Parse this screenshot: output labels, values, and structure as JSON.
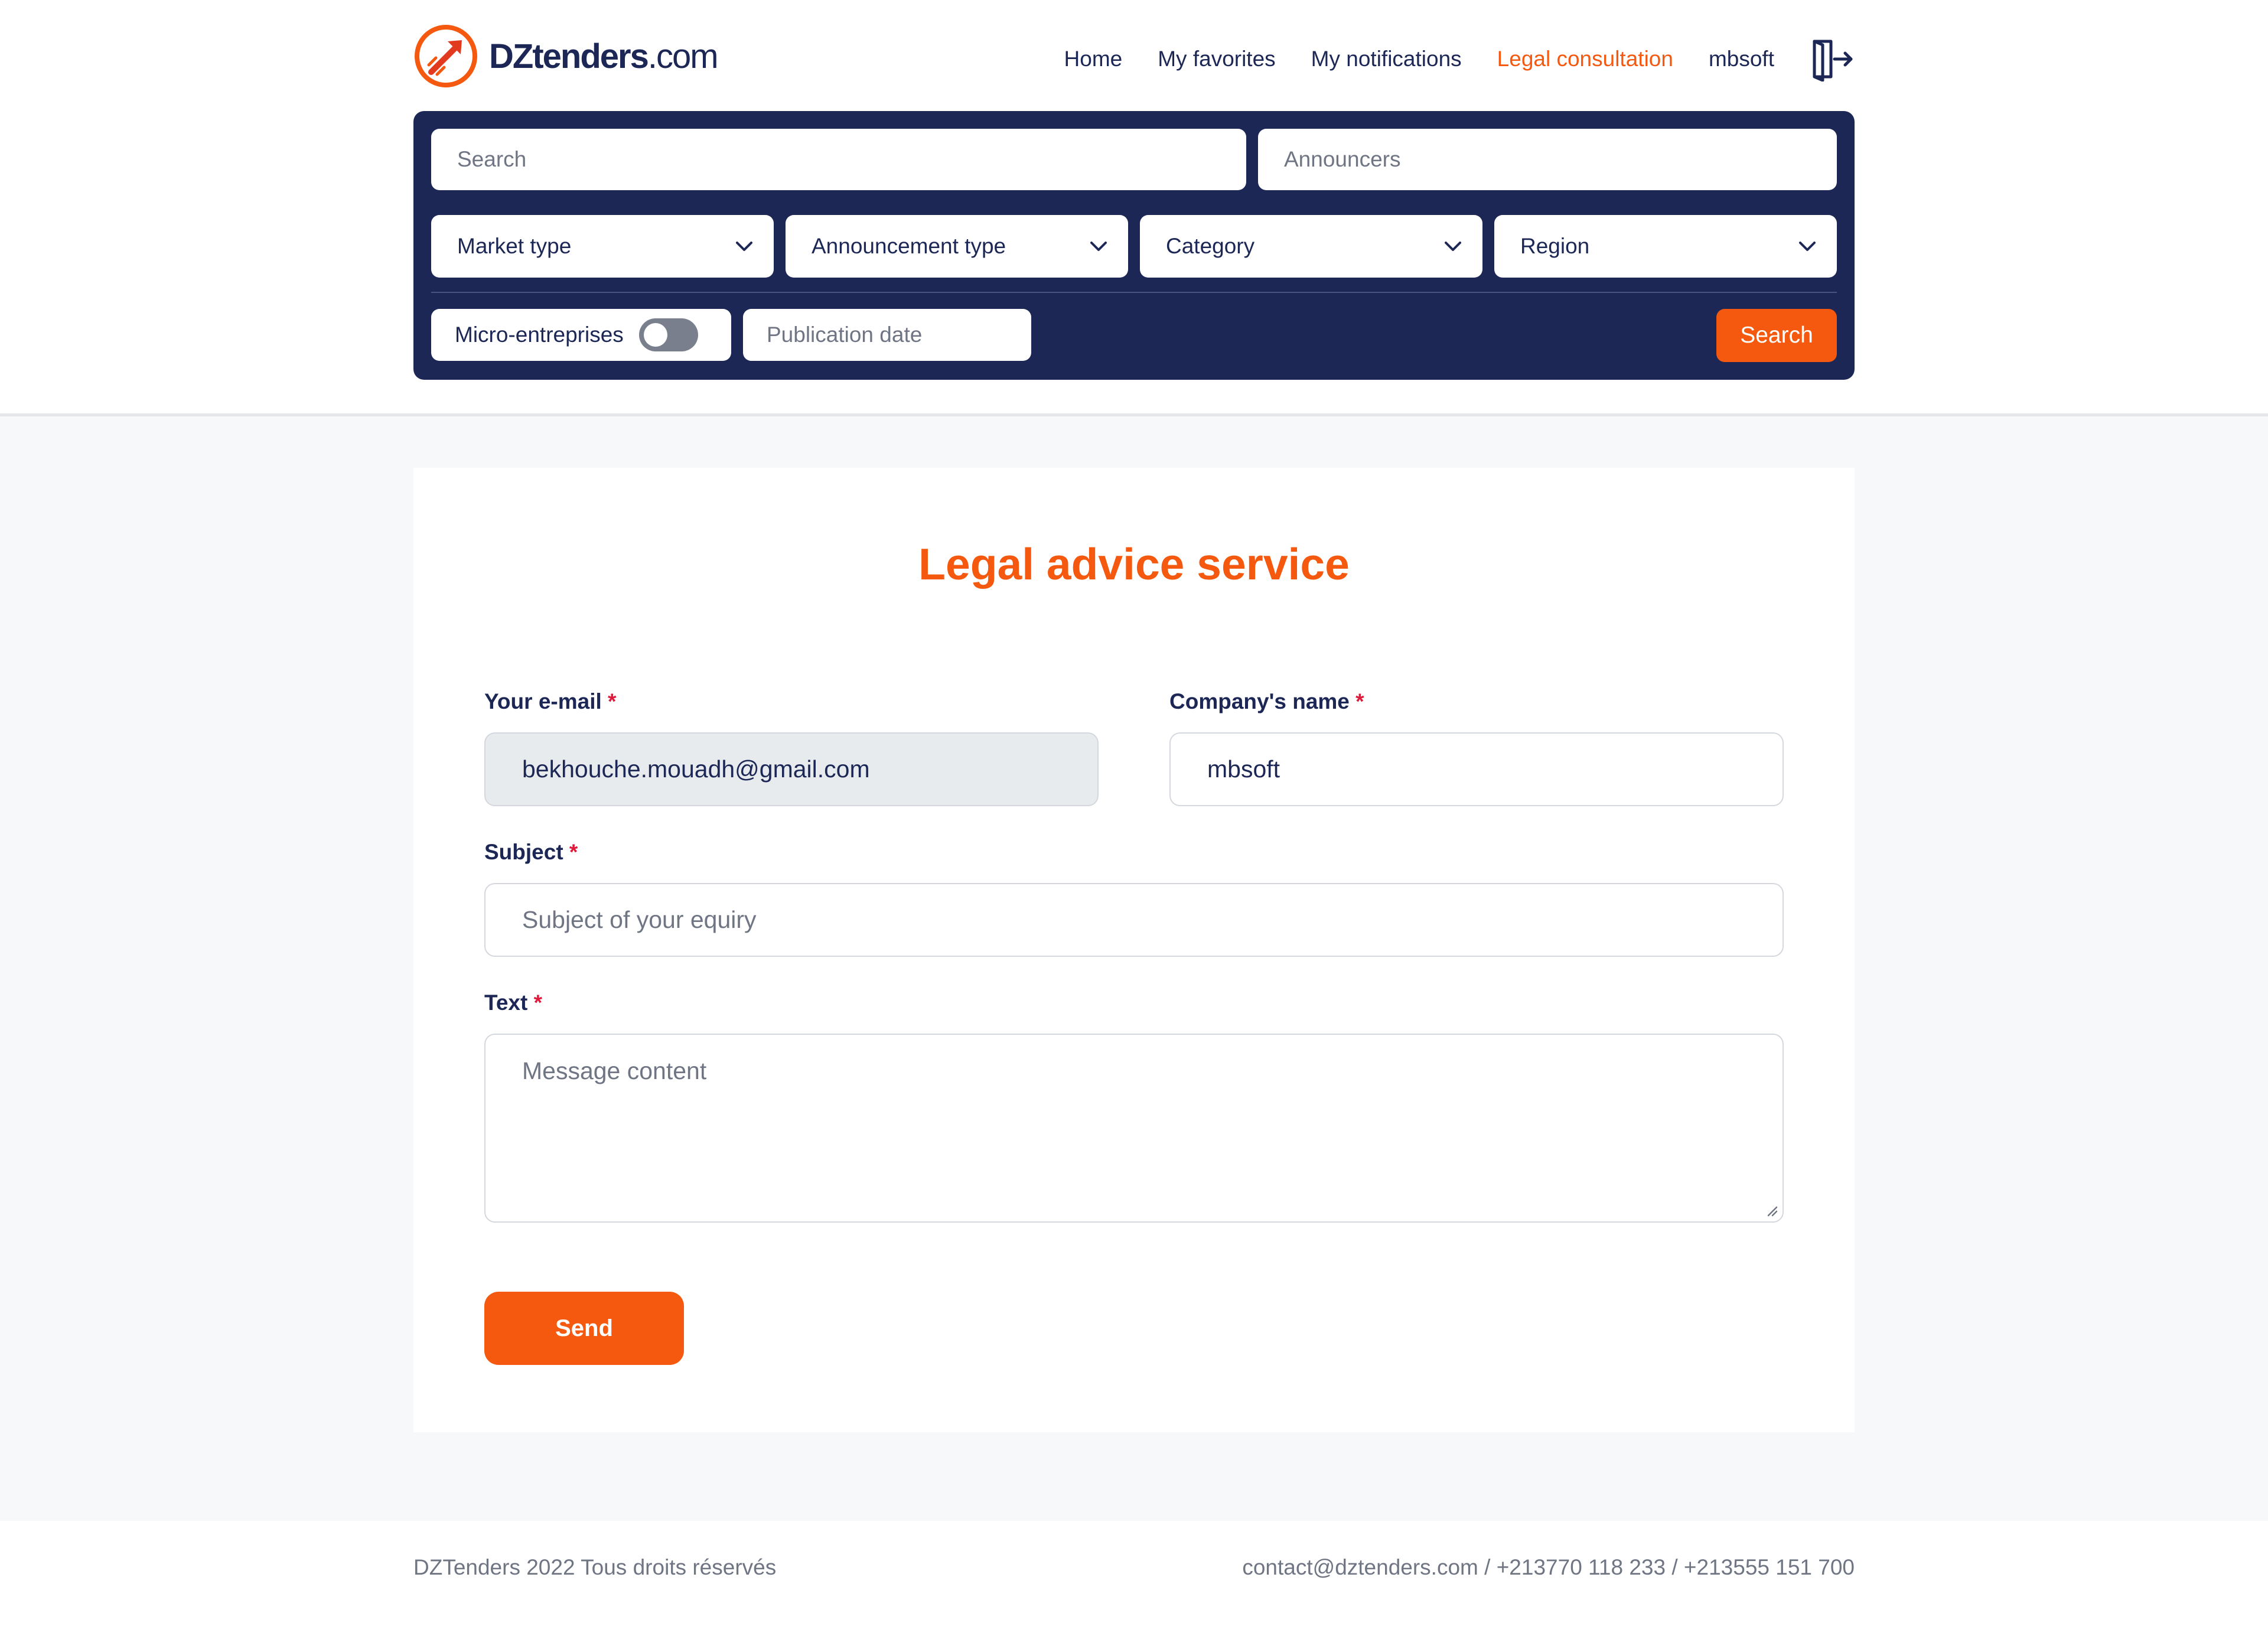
{
  "brand": {
    "name_bold": "DZtenders",
    "name_suffix": ".com",
    "accent": "#f4590f",
    "navy": "#1c2756"
  },
  "nav": {
    "items": [
      {
        "label": "Home",
        "active": false
      },
      {
        "label": "My favorites",
        "active": false
      },
      {
        "label": "My notifications",
        "active": false
      },
      {
        "label": "Legal consultation",
        "active": true
      },
      {
        "label": "mbsoft",
        "active": false
      }
    ],
    "logout_icon": "logout-icon"
  },
  "search": {
    "search_placeholder": "Search",
    "announcers_placeholder": "Announcers",
    "market_type": "Market type",
    "announcement_type": "Announcement type",
    "category": "Category",
    "region": "Region",
    "micro_label": "Micro-entreprises",
    "micro_enabled": false,
    "publication_date_placeholder": "Publication date",
    "search_button": "Search"
  },
  "form": {
    "title": "Legal advice service",
    "email_label": "Your e-mail",
    "email_value": "bekhouche.mouadh@gmail.com",
    "company_label": "Company's name",
    "company_value": "mbsoft",
    "subject_label": "Subject",
    "subject_placeholder": "Subject of your equiry",
    "text_label": "Text",
    "text_placeholder": "Message content",
    "required_mark": "*",
    "send_button": "Send"
  },
  "footer": {
    "copyright": "DZTenders 2022 Tous droits réservés",
    "contact": "contact@dztenders.com / +213770 118 233 / +213555 151 700"
  }
}
